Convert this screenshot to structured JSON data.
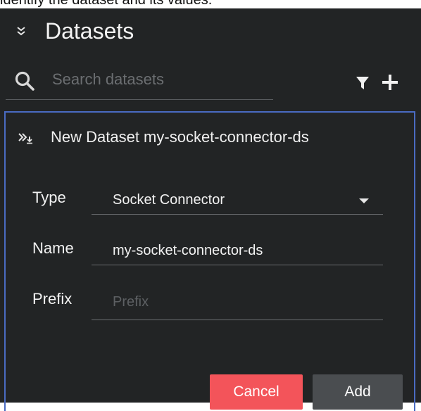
{
  "top_caption": "identify the dataset and its values.",
  "header": {
    "title": "Datasets"
  },
  "search": {
    "placeholder": "Search datasets",
    "value": ""
  },
  "card": {
    "title": "New Dataset my-socket-connector-ds",
    "fields": {
      "type": {
        "label": "Type",
        "value": "Socket Connector"
      },
      "name": {
        "label": "Name",
        "value": "my-socket-connector-ds"
      },
      "prefix": {
        "label": "Prefix",
        "value": "",
        "placeholder": "Prefix"
      }
    },
    "buttons": {
      "cancel": "Cancel",
      "add": "Add"
    }
  },
  "colors": {
    "panel_bg": "#222425",
    "card_border": "#4a6bc2",
    "cancel_bg": "#f3545a",
    "add_bg": "#4a4d50"
  },
  "icons": [
    "chevron-double-down-icon",
    "search-icon",
    "filter-icon",
    "plus-icon",
    "dataset-expand-icon",
    "caret-down-icon"
  ]
}
